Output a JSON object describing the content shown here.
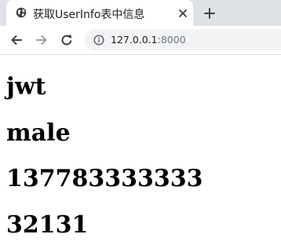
{
  "browser": {
    "tab": {
      "title": "获取UserInfo表中信息"
    },
    "address_bar": {
      "host": "127.0.0.1",
      "port": ":8000"
    },
    "icons": {
      "favicon": "globe-icon",
      "close": "close-icon",
      "new_tab": "plus-icon",
      "back": "arrow-left-icon",
      "forward": "arrow-right-icon",
      "reload": "reload-icon",
      "site_info": "info-icon"
    }
  },
  "page": {
    "fields": [
      "jwt",
      "male",
      "137783333333",
      "32131"
    ]
  }
}
